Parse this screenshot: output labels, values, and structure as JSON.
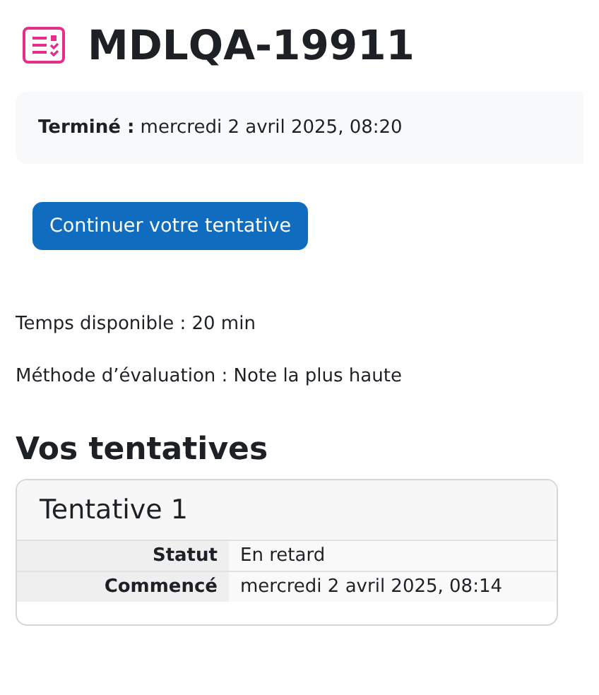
{
  "page_title": "MDLQA-19911",
  "summary": "**Terminé :** mercredi 2 avril 2025, 08:20",
  "continue_button": "Continuer votre tentative",
  "info_lines": [
    "Temps disponible : 20 min",
    "Méthode d’évaluation : Note la plus haute"
  ],
  "attempts_heading": "Vos tentatives",
  "attempts": [
    {
      "title": "Tentative 1",
      "rows": [
        {
          "label": "Statut",
          "value": "En retard"
        },
        {
          "label": "Commencé",
          "value": "mercredi 2 avril 2025, 08:14"
        }
      ]
    }
  ]
}
